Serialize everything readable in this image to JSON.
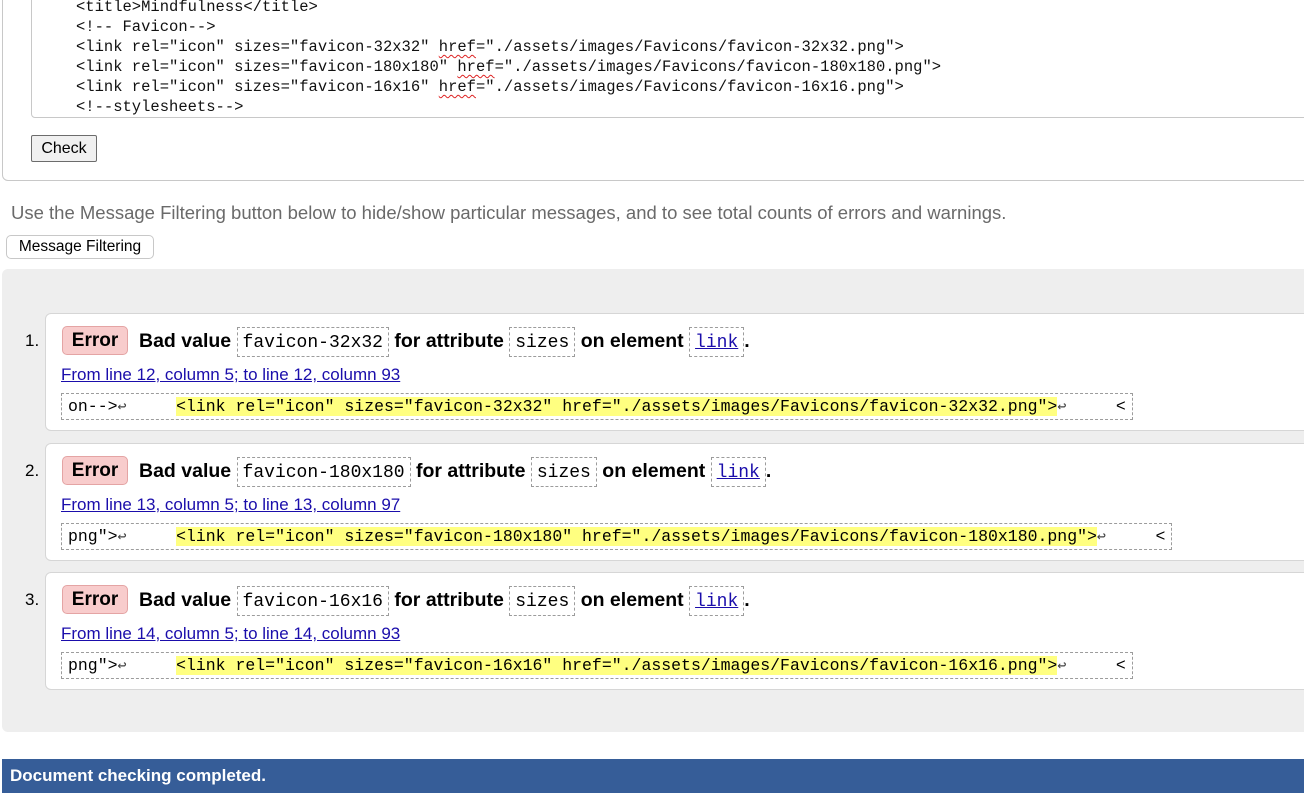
{
  "source": {
    "lines": [
      {
        "text": "<title>Mindfulness</title>",
        "parts": null
      },
      {
        "text": "<!-- Favicon-->",
        "parts": null
      },
      {
        "pre": "<link rel=\"icon\" sizes=\"favicon-32x32\" ",
        "href": "href",
        "post": "=\"./assets/images/Favicons/favicon-32x32.png\">"
      },
      {
        "pre": "<link rel=\"icon\" sizes=\"favicon-180x180\" ",
        "href": "href",
        "post": "=\"./assets/images/Favicons/favicon-180x180.png\">"
      },
      {
        "pre": "<link rel=\"icon\" sizes=\"favicon-16x16\" ",
        "href": "href",
        "post": "=\"./assets/images/Favicons/favicon-16x16.png\">"
      },
      {
        "text": "<!--stylesheets-->",
        "parts": null
      }
    ]
  },
  "check_button": "Check",
  "filter_info": "Use the Message Filtering button below to hide/show particular messages, and to see total counts of errors and warnings.",
  "filter_button": "Message Filtering",
  "messages": [
    {
      "number": "1.",
      "type": "Error",
      "bad_value_label": "Bad value",
      "value": "favicon-32x32",
      "for_attr_label": "for attribute",
      "attribute": "sizes",
      "on_element_label": "on element",
      "element": "link",
      "period": ".",
      "location": "From line 12, column 5; to line 12, column 93",
      "extract_pre": "on-->",
      "extract_highlight": "<link rel=\"icon\" sizes=\"favicon-32x32\" href=\"./assets/images/Favicons/favicon-32x32.png\">",
      "extract_post": "<",
      "return_symbol": "↩"
    },
    {
      "number": "2.",
      "type": "Error",
      "bad_value_label": "Bad value",
      "value": "favicon-180x180",
      "for_attr_label": "for attribute",
      "attribute": "sizes",
      "on_element_label": "on element",
      "element": "link",
      "period": ".",
      "location": "From line 13, column 5; to line 13, column 97",
      "extract_pre": "png\">",
      "extract_highlight": "<link rel=\"icon\" sizes=\"favicon-180x180\" href=\"./assets/images/Favicons/favicon-180x180.png\">",
      "extract_post": "<",
      "return_symbol": "↩"
    },
    {
      "number": "3.",
      "type": "Error",
      "bad_value_label": "Bad value",
      "value": "favicon-16x16",
      "for_attr_label": "for attribute",
      "attribute": "sizes",
      "on_element_label": "on element",
      "element": "link",
      "period": ".",
      "location": "From line 14, column 5; to line 14, column 93",
      "extract_pre": "png\">",
      "extract_highlight": "<link rel=\"icon\" sizes=\"favicon-16x16\" href=\"./assets/images/Favicons/favicon-16x16.png\">",
      "extract_post": "<",
      "return_symbol": "↩"
    }
  ],
  "status": "Document checking completed.",
  "colors": {
    "error_badge_bg": "#f8cccc",
    "highlight": "#ffff80",
    "status_bar": "#365d98",
    "link": "#1a0dab"
  }
}
